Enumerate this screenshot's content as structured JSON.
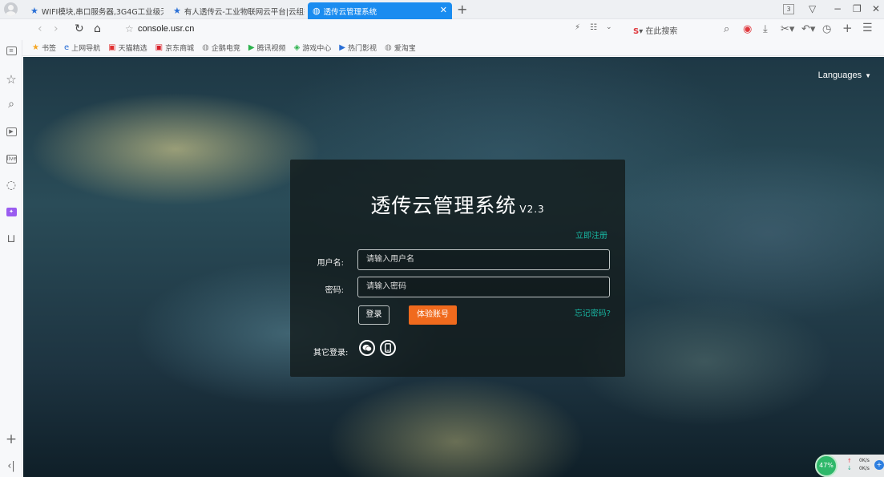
{
  "browser": {
    "tabs": [
      {
        "title": "WIFI模块,串口服务器,3G4G工业级无",
        "active": false
      },
      {
        "title": "有人透传云-工业物联网云平台|云组态",
        "active": false
      },
      {
        "title": "透传云管理系统",
        "active": true
      }
    ],
    "tab_count": "3",
    "url": "console.usr.cn",
    "search_placeholder": "在此搜索",
    "bookmarks": [
      {
        "label": "书签",
        "icon": "star-icon"
      },
      {
        "label": "上网导航",
        "icon": "ie-icon"
      },
      {
        "label": "天猫精选",
        "icon": "tmall-icon"
      },
      {
        "label": "京东商城",
        "icon": "jd-icon"
      },
      {
        "label": "企鹅电竞",
        "icon": "globe-icon"
      },
      {
        "label": "腾讯视频",
        "icon": "play-icon"
      },
      {
        "label": "游戏中心",
        "icon": "gamepad-icon"
      },
      {
        "label": "热门影视",
        "icon": "play-icon"
      },
      {
        "label": "爱淘宝",
        "icon": "globe-icon"
      }
    ],
    "net_widget": {
      "percent": "47%",
      "up": "0K/s",
      "down": "0K/s"
    }
  },
  "page": {
    "languages": "Languages",
    "title": "透传云管理系统",
    "version": "V2.3",
    "register": "立即注册",
    "username_label": "用户名:",
    "username_placeholder": "请输入用户名",
    "password_label": "密码:",
    "password_placeholder": "请输入密码",
    "login_button": "登录",
    "trial_button": "体验账号",
    "forgot": "忘记密码?",
    "other_login_label": "其它登录:",
    "colors": {
      "accent": "#18b4a0",
      "trial": "#f06a1d",
      "tab_active": "#1a8cf0"
    }
  }
}
